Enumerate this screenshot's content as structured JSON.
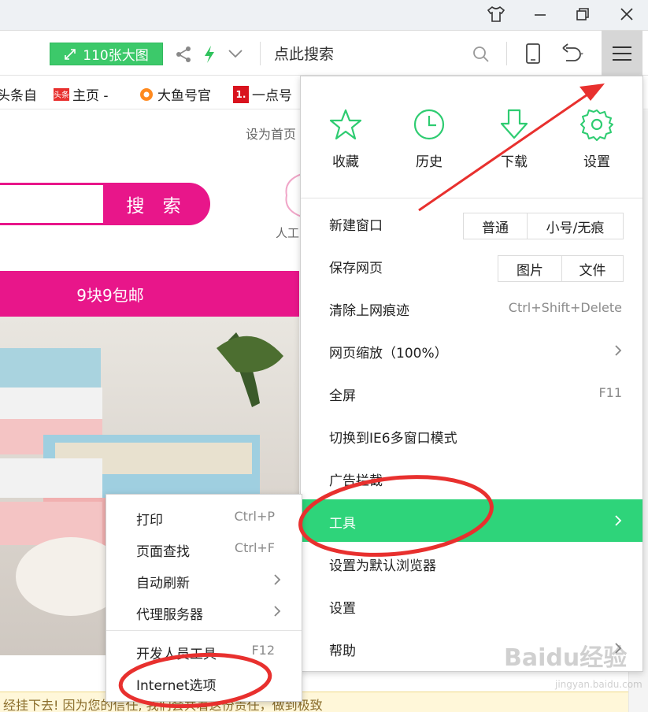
{
  "toolbar": {
    "big_image_label": "110张大图",
    "search_placeholder": "点此搜索"
  },
  "bookmarks": [
    {
      "label": "头条自",
      "badge": ""
    },
    {
      "label": "主页 -",
      "badge": "头条"
    },
    {
      "label": "大鱼号官",
      "badge": ""
    },
    {
      "label": "一点号",
      "badge": "1."
    }
  ],
  "page": {
    "set_home": "设为首页",
    "search_button": "搜 索",
    "side_text": "人工",
    "banner": "9块9包邮",
    "bottom_note": "经挂下去! 因为您的信任, 我们会共着这份责任，做到极致"
  },
  "menu": {
    "quick_actions": [
      {
        "label": "收藏",
        "icon": "star-icon"
      },
      {
        "label": "历史",
        "icon": "clock-icon"
      },
      {
        "label": "下载",
        "icon": "download-icon"
      },
      {
        "label": "设置",
        "icon": "gear-icon"
      }
    ],
    "items": [
      {
        "label": "新建窗口",
        "options": [
          "普通",
          "小号/无痕"
        ]
      },
      {
        "label": "保存网页",
        "options": [
          "图片",
          "文件"
        ]
      },
      {
        "label": "清除上网痕迹",
        "shortcut": "Ctrl+Shift+Delete"
      },
      {
        "label": "网页缩放（100%）",
        "submenu": true
      },
      {
        "label": "全屏",
        "shortcut": "F11"
      },
      {
        "label": "切换到IE6多窗口模式"
      },
      {
        "label": "广告拦截"
      },
      {
        "label": "工具",
        "submenu": true,
        "active": true
      },
      {
        "label": "设置为默认浏览器"
      },
      {
        "label": "设置"
      },
      {
        "label": "帮助",
        "submenu": true
      }
    ]
  },
  "submenu": {
    "items": [
      {
        "label": "打印",
        "shortcut": "Ctrl+P"
      },
      {
        "label": "页面查找",
        "shortcut": "Ctrl+F"
      },
      {
        "label": "自动刷新",
        "submenu": true
      },
      {
        "label": "代理服务器",
        "submenu": true
      },
      {
        "label": "开发人员工具",
        "shortcut": "F12"
      },
      {
        "label": "Internet选项"
      }
    ]
  },
  "watermark": {
    "text": "Baidu经验",
    "sub": "jingyan.baidu.com"
  },
  "colors": {
    "accent_green": "#2ed47a",
    "brand_pink": "#e8168a",
    "annotation_red": "#e8302e"
  }
}
